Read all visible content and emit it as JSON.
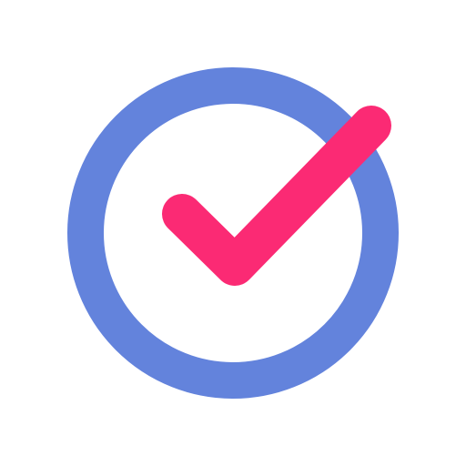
{
  "icon": {
    "name": "check-circle-icon",
    "colors": {
      "background": "#ffffff",
      "ring": "#6383dc",
      "check": "#fb2a74"
    }
  }
}
